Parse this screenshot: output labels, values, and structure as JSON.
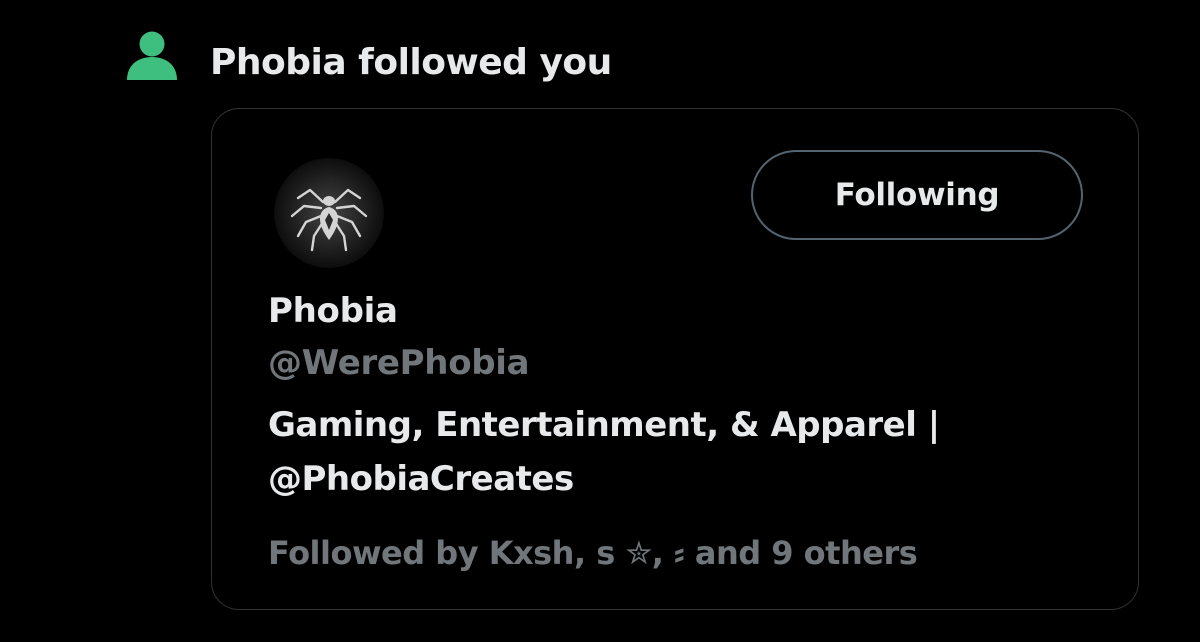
{
  "notification": {
    "icon": "person-icon",
    "icon_color": "#3fbf7f",
    "title": "Phobia followed you"
  },
  "user_card": {
    "avatar": "spider-avatar",
    "follow_button_label": "Following",
    "display_name": "Phobia",
    "handle": "@WerePhobia",
    "bio_line_1": "Gaming, Entertainment, & Apparel |",
    "bio_line_2": "@PhobiaCreates",
    "followed_by": "Followed by Kxsh, s ✮, ⸗ and 9 others"
  },
  "colors": {
    "background": "#000000",
    "primary_text": "#e7e9ea",
    "secondary_text": "#71767b",
    "card_border": "#2f3336",
    "button_border": "#536471"
  }
}
